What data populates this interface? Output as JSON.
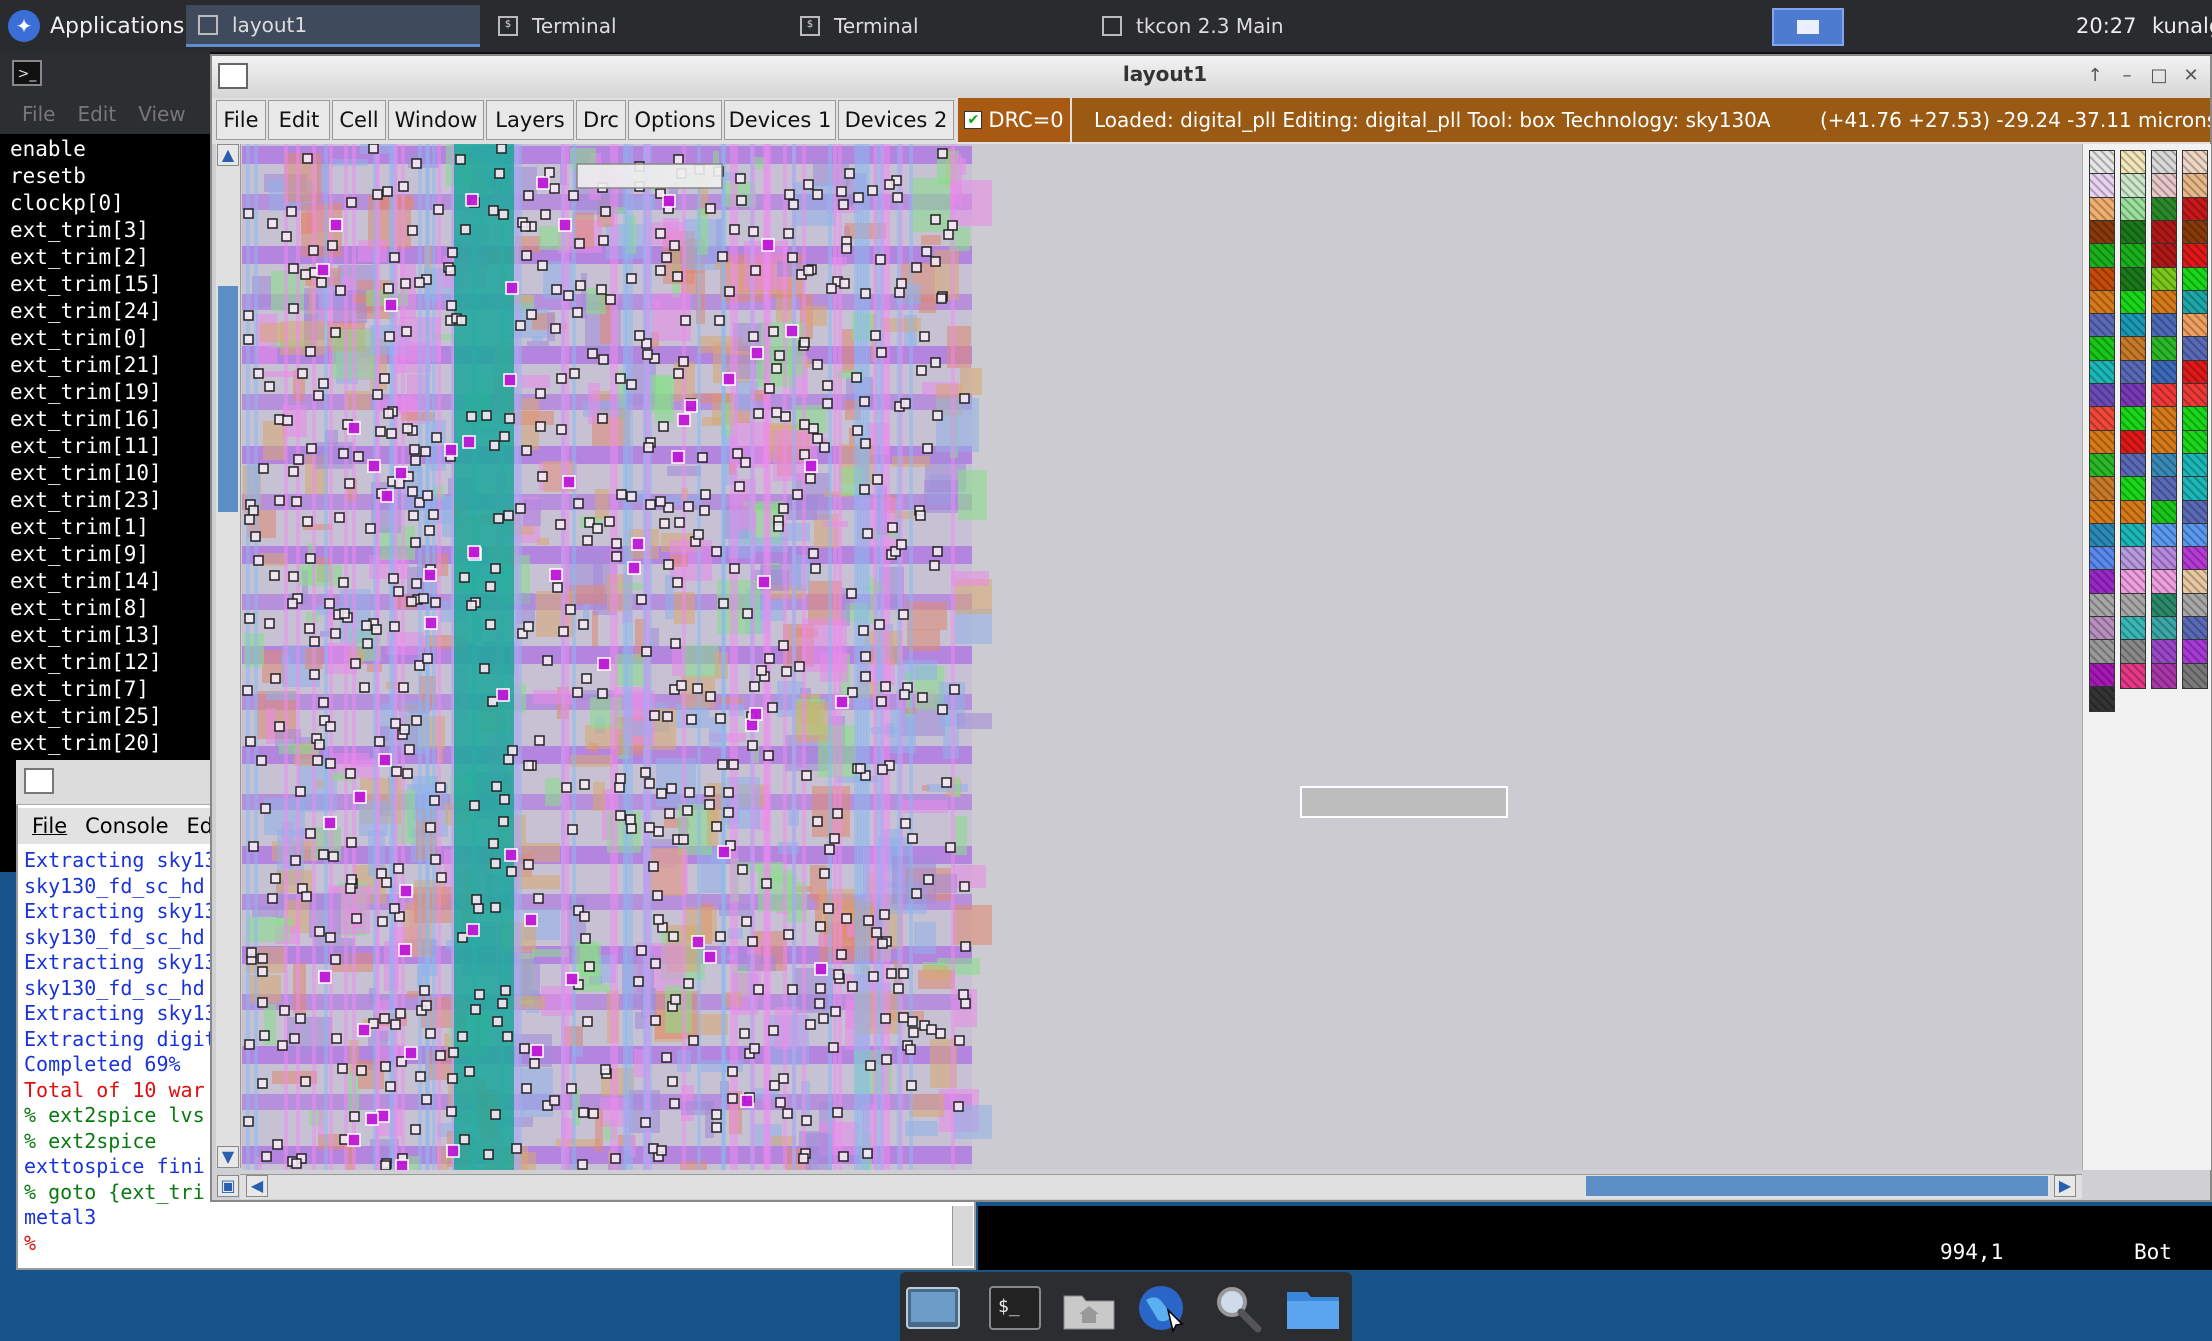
{
  "panel": {
    "apps_label": "Applications",
    "tasks": [
      {
        "label": "layout1",
        "active": true
      },
      {
        "label": "Terminal",
        "active": false
      },
      {
        "label": "Terminal",
        "active": false
      },
      {
        "label": "tkcon 2.3 Main",
        "active": false
      }
    ],
    "clock": "20:27",
    "user": "kunalg"
  },
  "left_terminal": {
    "menu": [
      "File",
      "Edit",
      "View"
    ],
    "nets": [
      "enable",
      "resetb",
      "clockp[0]",
      "ext_trim[3]",
      "ext_trim[2]",
      "ext_trim[15]",
      "ext_trim[24]",
      "ext_trim[0]",
      "ext_trim[21]",
      "ext_trim[19]",
      "ext_trim[16]",
      "ext_trim[11]",
      "ext_trim[10]",
      "ext_trim[23]",
      "ext_trim[1]",
      "ext_trim[9]",
      "ext_trim[14]",
      "ext_trim[8]",
      "ext_trim[13]",
      "ext_trim[12]",
      "ext_trim[7]",
      "ext_trim[25]",
      "ext_trim[20]"
    ]
  },
  "tkcon": {
    "menu": [
      "File",
      "Console",
      "Ed"
    ],
    "lines": [
      {
        "text": "Extracting sky13",
        "color": "blue"
      },
      {
        "text": "sky130_fd_sc_hd",
        "color": "blue"
      },
      {
        "text": "Extracting sky13",
        "color": "blue"
      },
      {
        "text": "sky130_fd_sc_hd",
        "color": "blue"
      },
      {
        "text": "Extracting sky13",
        "color": "blue"
      },
      {
        "text": "sky130_fd_sc_hd",
        "color": "blue"
      },
      {
        "text": "Extracting sky13",
        "color": "blue"
      },
      {
        "text": "Extracting digit",
        "color": "blue"
      },
      {
        "text": "Completed 69%",
        "color": "blue"
      },
      {
        "text": "Total of 10 war",
        "color": "red"
      },
      {
        "text": "% ext2spice lvs",
        "color": "green"
      },
      {
        "text": "% ext2spice",
        "color": "green"
      },
      {
        "text": "exttospice fini",
        "color": "blue"
      },
      {
        "text": "% goto {ext_tri",
        "color": "green"
      },
      {
        "text": "metal3",
        "color": "blue"
      },
      {
        "text": "%",
        "color": "red"
      }
    ]
  },
  "vim": {
    "position": "994,1",
    "scroll": "Bot"
  },
  "magic": {
    "title": "layout1",
    "menu": [
      "File",
      "Edit",
      "Cell",
      "Window",
      "Layers",
      "Drc",
      "Options",
      "Devices 1",
      "Devices 2"
    ],
    "drc": "DRC=0",
    "status": "Loaded: digital_pll Editing: digital_pll Tool: box  Technology: sky130A",
    "coords": "(+41.76 +27.53) -29.24 -37.11 microns",
    "palette_colors": [
      [
        "#e6e6e6",
        "#f3e7b9",
        "#d9d9d9",
        "#f0d6c4"
      ],
      [
        "#e8d4f0",
        "#cde8cd",
        "#e8c8c8",
        "#e8b88a"
      ],
      [
        "#f0b070",
        "#9be09b",
        "#2a8a2a",
        "#c81818"
      ],
      [
        "#8a3a08",
        "#1a7a1a",
        "#b01818",
        "#8a3a08"
      ],
      [
        "#1ab21a",
        "#1ab21a",
        "#b01818",
        "#e01818"
      ],
      [
        "#c84a08",
        "#1a7a1a",
        "#7ac81a",
        "#18d818"
      ],
      [
        "#d87a18",
        "#18d818",
        "#d87a18",
        "#1aa8a8"
      ],
      [
        "#5a6ab8",
        "#1a9ab8",
        "#4a6ab8",
        "#f0a060"
      ],
      [
        "#18c818",
        "#c87a28",
        "#28b828",
        "#5a6ab8"
      ],
      [
        "#1ab8b8",
        "#5a6ab8",
        "#3a6ab8",
        "#e01818"
      ],
      [
        "#6a4ab8",
        "#7a3ab8",
        "#f03838",
        "#f03838"
      ],
      [
        "#f04838",
        "#18d818",
        "#d87a18",
        "#18d818"
      ],
      [
        "#d87a18",
        "#e01818",
        "#d87a18",
        "#18d818"
      ],
      [
        "#28b828",
        "#5a6ab8",
        "#3a8ab8",
        "#1ab8b8"
      ],
      [
        "#c87a28",
        "#18d818",
        "#5a6ab8",
        "#1ab8b8"
      ],
      [
        "#d87a18",
        "#d87a18",
        "#18c818",
        "#5a6ab8"
      ],
      [
        "#2a8ab8",
        "#1ab8b8",
        "#5a9af0",
        "#5a9af0"
      ],
      [
        "#5a8af0",
        "#b89ae0",
        "#b888e0",
        "#b838d8"
      ],
      [
        "#9a28c8",
        "#f0a0e0",
        "#f0a0e0",
        "#e8c8a0"
      ],
      [
        "#a8a8a8",
        "#a8a8a8",
        "#2a8a6a",
        "#a8a8a8"
      ],
      [
        "#b890c0",
        "#3ab8b8",
        "#3aa8a8",
        "#5a6ab8"
      ],
      [
        "#9a9a9a",
        "#8a8a8a",
        "#9a48c8",
        "#a838d8"
      ],
      [
        "#a818b8",
        "#e83888",
        "#a838a8",
        "#7a7a7a"
      ],
      [
        "#333333"
      ]
    ]
  },
  "dock": {
    "items": [
      "desktop-icon",
      "terminal-icon",
      "home-folder-icon",
      "web-browser-icon",
      "search-icon",
      "files-icon"
    ]
  }
}
